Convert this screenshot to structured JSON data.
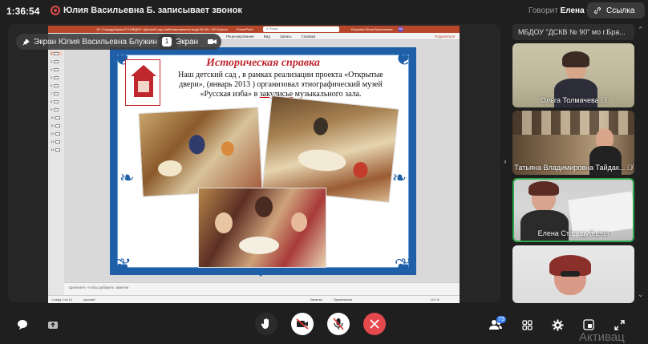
{
  "topbar": {
    "time": "1:36:54",
    "recording_text": "Юлия Васильевна Б. записывает звонок",
    "speaking_label": "Говорит",
    "speaking_name": "Елена С.",
    "link_button": "Ссылка"
  },
  "stage": {
    "pin_label": "Экран Юлия Васильевна Блужина",
    "screen_badge": "Экран",
    "screen_count": "1"
  },
  "powerpoint": {
    "title": "18. Стародубцева Е.Н.МБДОУ «Детский сад комбинированного вида № 90», МО Братск",
    "app_name": "PowerPoint",
    "search_placeholder": "Поиск",
    "user_name": "Блужина Юлия Васильевна",
    "user_initials": "ЮБ",
    "ribbon_tabs": [
      "Рецензирование",
      "Вид",
      "Запись",
      "Справка"
    ],
    "share_label": "Поделиться",
    "thumb_numbers": [
      "1",
      "2",
      "3",
      "4",
      "5",
      "6",
      "7",
      "8",
      "9",
      "10",
      "11",
      "12",
      "13",
      "14"
    ],
    "notes_placeholder": "Щелкните, чтобы добавить заметки",
    "status_slide": "Слайд 2 из 14",
    "status_lang": "русский",
    "status_notes": "Заметки",
    "status_comments": "Примечания",
    "zoom": "114 %"
  },
  "slide": {
    "title": "Историческая справка",
    "text_line1": "Наш детский сад ,  в рамках  реализации проекта «Открытые",
    "text_line2": "двери», (январь 2013 ) организовал этнографический  музей",
    "text_line3_before": "«Русская изба» в ",
    "text_line3_underlined": "закулисье",
    "text_line3_after": " музыкального зала."
  },
  "sidebar": {
    "school_name": "МБДОУ \"ДСКВ № 90\" мо г.Бра...",
    "participants": [
      {
        "name": "Ольга Толмачева"
      },
      {
        "name": "Татьяна Владимировна Тайдак..."
      },
      {
        "name": "Елена Стародубцева"
      },
      {
        "name": ""
      }
    ]
  },
  "controls": {
    "participants_count": "73",
    "activation_text": "Активац"
  }
}
